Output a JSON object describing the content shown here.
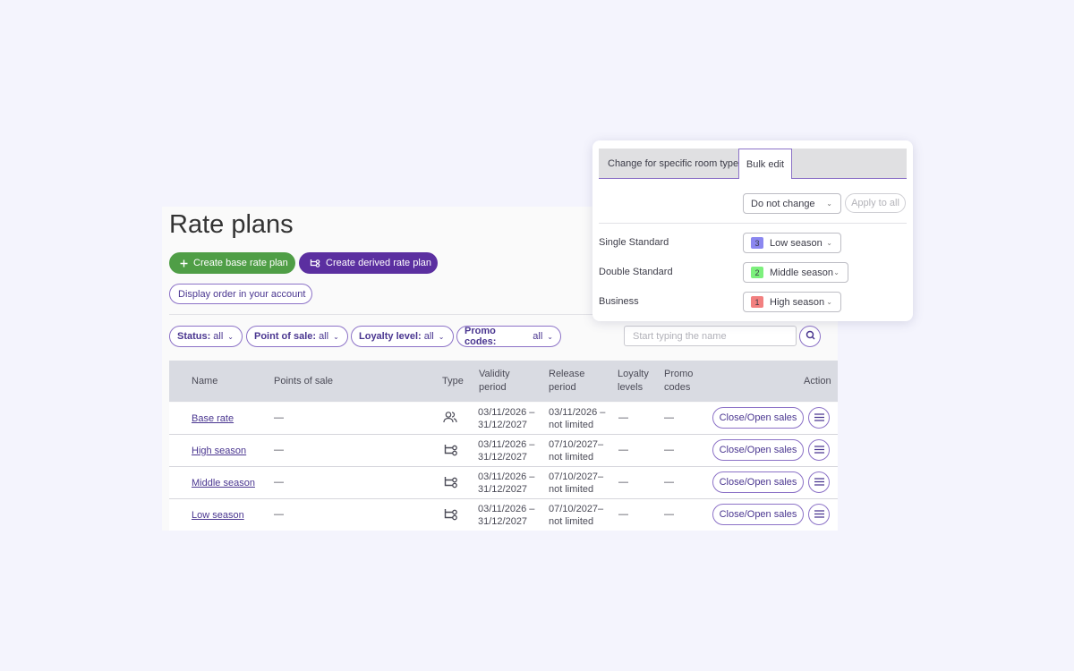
{
  "page": {
    "title": "Rate plans",
    "buttons": {
      "create_base": "Create base rate plan",
      "create_derived": "Create derived rate plan",
      "display_order": "Display order in your account"
    },
    "filters": [
      {
        "label": "Status:",
        "value": "all"
      },
      {
        "label": "Point of sale:",
        "value": "all"
      },
      {
        "label": "Loyalty level:",
        "value": "all"
      },
      {
        "label": "Promo codes:",
        "value": "all"
      }
    ],
    "search": {
      "placeholder": "Start typing the name"
    },
    "table": {
      "headers": {
        "name": "Name",
        "points_of_sale": "Points of sale",
        "type": "Type",
        "validity_1": "Validity",
        "validity_2": "period",
        "release_1": "Release",
        "release_2": "period",
        "loyalty_1": "Loyalty",
        "loyalty_2": "levels",
        "promo_1": "Promo",
        "promo_2": "codes",
        "action": "Action"
      },
      "rows": [
        {
          "name": "Base rate",
          "pos": "—",
          "type_icon": "users-icon",
          "validity_1": "03/11/2026 –",
          "validity_2": "31/12/2027",
          "release_1": "03/11/2026 –",
          "release_2": "not limited",
          "loyalty": "—",
          "promo": "—",
          "action": "Close/Open sales"
        },
        {
          "name": "High season",
          "pos": "—",
          "type_icon": "derived-icon",
          "validity_1": "03/11/2026 –",
          "validity_2": "31/12/2027",
          "release_1": "07/10/2027–",
          "release_2": "not limited",
          "loyalty": "—",
          "promo": "—",
          "action": "Close/Open sales"
        },
        {
          "name": "Middle season",
          "pos": "—",
          "type_icon": "derived-icon",
          "validity_1": "03/11/2026 –",
          "validity_2": "31/12/2027",
          "release_1": "07/10/2027–",
          "release_2": "not limited",
          "loyalty": "—",
          "promo": "—",
          "action": "Close/Open sales"
        },
        {
          "name": "Low season",
          "pos": "—",
          "type_icon": "derived-icon",
          "validity_1": "03/11/2026 –",
          "validity_2": "31/12/2027",
          "release_1": "07/10/2027–",
          "release_2": "not limited",
          "loyalty": "—",
          "promo": "—",
          "action": "Close/Open sales"
        }
      ]
    }
  },
  "popup": {
    "tabs": [
      "Change for specific room type",
      "Bulk edit"
    ],
    "active_tab": "Bulk edit",
    "bulk_select": "Do not change",
    "apply_all": "Apply to all",
    "rooms": [
      {
        "name": "Single Standard",
        "badge": "3",
        "badge_color": "#8b87f0",
        "value": "Low season"
      },
      {
        "name": "Double Standard",
        "badge": "2",
        "badge_color": "#7df07d",
        "value": "Middle season"
      },
      {
        "name": "Business",
        "badge": "1",
        "badge_color": "#f28080",
        "value": "High season"
      }
    ]
  },
  "colors": {
    "accent": "#8c72c7",
    "primary_purple": "#5b2fa0",
    "green": "#4f9e46"
  }
}
